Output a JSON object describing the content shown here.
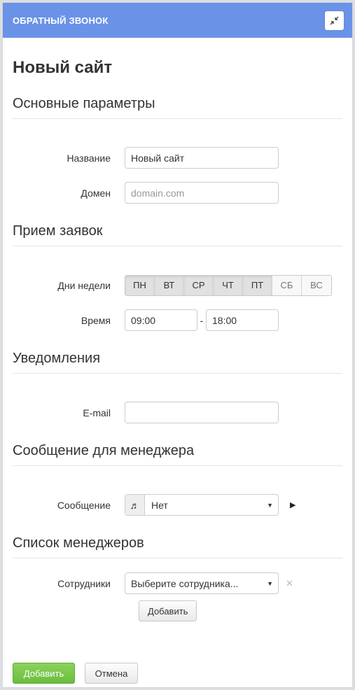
{
  "header": {
    "title": "ОБРАТНЫЙ ЗВОНОК",
    "collapse_icon": "collapse-arrows-icon"
  },
  "page_title": "Новый сайт",
  "sections": {
    "basic": {
      "title": "Основные параметры",
      "name_label": "Название",
      "name_value": "Новый сайт",
      "domain_label": "Домен",
      "domain_placeholder": "domain.com"
    },
    "requests": {
      "title": "Прием заявок",
      "days_label": "Дни недели",
      "days": [
        {
          "label": "ПН",
          "active": true
        },
        {
          "label": "ВТ",
          "active": true
        },
        {
          "label": "СР",
          "active": true
        },
        {
          "label": "ЧТ",
          "active": true
        },
        {
          "label": "ПТ",
          "active": true
        },
        {
          "label": "СБ",
          "active": false
        },
        {
          "label": "ВС",
          "active": false
        }
      ],
      "time_label": "Время",
      "time_from": "09:00",
      "time_separator": "-",
      "time_to": "18:00"
    },
    "notifications": {
      "title": "Уведомления",
      "email_label": "E-mail",
      "email_value": ""
    },
    "manager_message": {
      "title": "Сообщение для менеджера",
      "message_label": "Сообщение",
      "message_value": "Нет",
      "music_icon": "music-note-icon",
      "play_icon": "play-icon"
    },
    "managers": {
      "title": "Список менеджеров",
      "employees_label": "Сотрудники",
      "employees_placeholder": "Выберите сотрудника...",
      "add_label": "Добавить"
    }
  },
  "footer": {
    "submit_label": "Добавить",
    "cancel_label": "Отмена"
  },
  "colors": {
    "header": "#6a93e8",
    "primary_button": "#72c144"
  }
}
